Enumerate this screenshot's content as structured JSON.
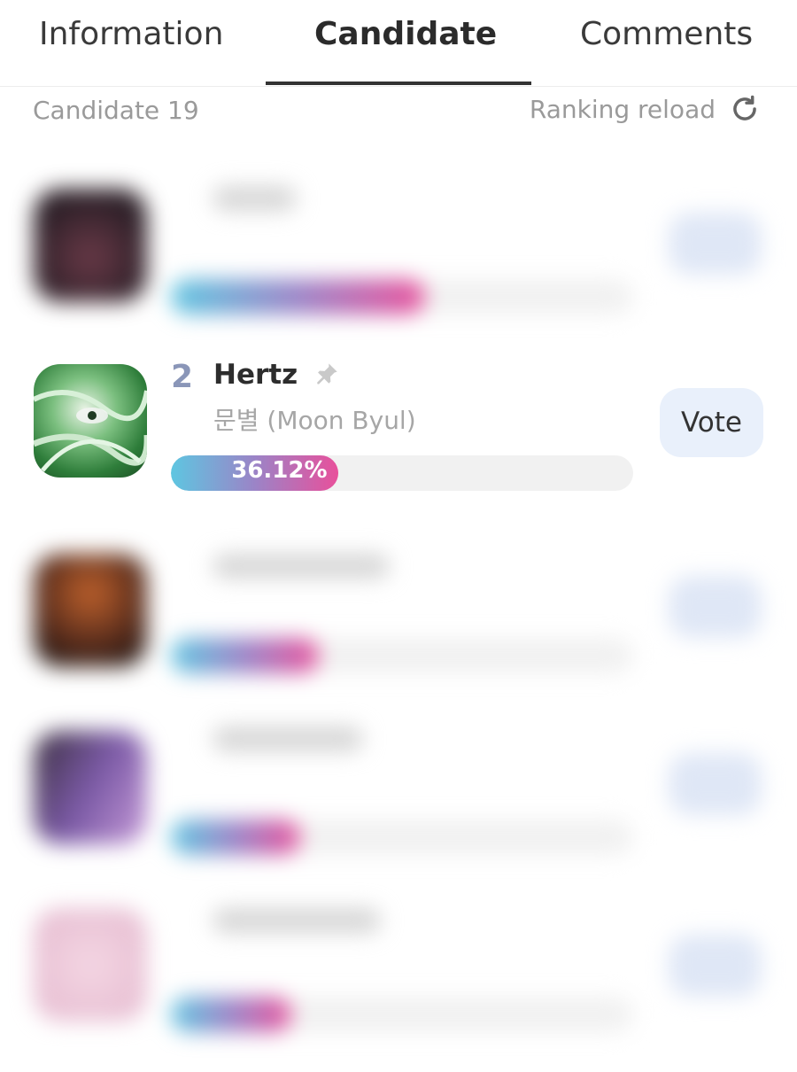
{
  "tabs": [
    {
      "label": "Information"
    },
    {
      "label": "Candidate"
    },
    {
      "label": "Comments"
    }
  ],
  "subheader": {
    "candidate_count": "Candidate 19",
    "reload_label": "Ranking reload"
  },
  "candidates": [
    {
      "rank": "",
      "title": "",
      "artist": "",
      "progress": 0.55
    },
    {
      "rank": "2",
      "title": "Hertz",
      "artist": "문별 (Moon Byul)",
      "progress": 0.3612,
      "percent_label": "36.12%",
      "vote_label": "Vote"
    },
    {
      "rank": "",
      "title": "",
      "artist": "",
      "progress": 0.32
    },
    {
      "rank": "",
      "title": "",
      "artist": "",
      "progress": 0.28
    },
    {
      "rank": "",
      "title": "",
      "artist": "",
      "progress": 0.26
    }
  ],
  "colors": {
    "bar_start": "#5ec6e1",
    "bar_end": "#e8509b",
    "vote_bg": "#e9f0fb",
    "rank_color": "#8a96b8"
  },
  "icons": {
    "reload": "refresh-icon",
    "pin": "pin-icon"
  }
}
